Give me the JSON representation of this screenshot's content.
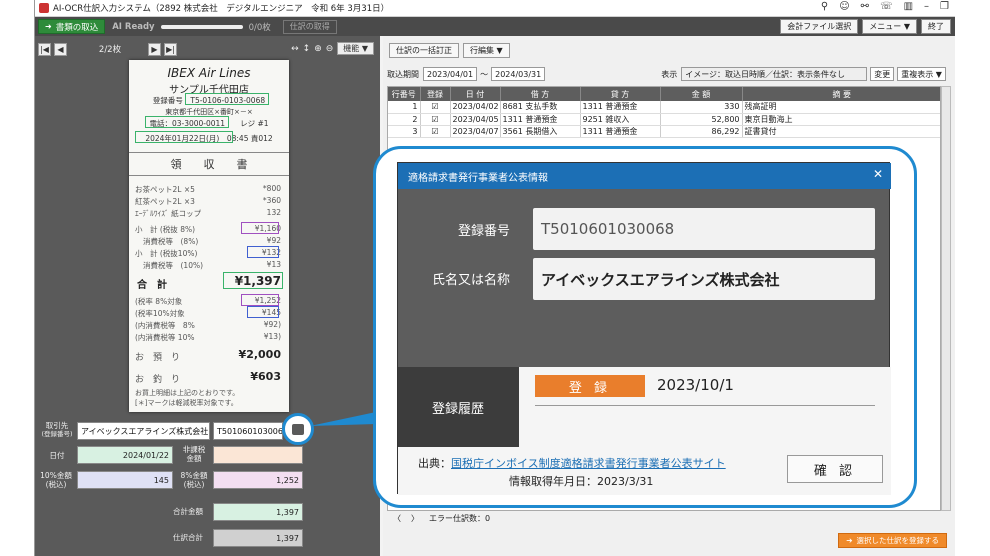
{
  "app": {
    "title": "AI-OCR仕訳入力システム（2892 株式会社　デジタルエンジニア　令和 6年 3月31日）",
    "import_button": "書類の取込",
    "ai_status": "AI Ready",
    "progress_count": "0/0枚",
    "fetch_button": "仕訳の取得",
    "account_file_button": "会計ファイル選択",
    "menu_button": "メニュー ▼",
    "exit_button": "終了"
  },
  "viewer": {
    "page_count": "2/2枚",
    "function_button": "機能 ▼"
  },
  "receipt": {
    "store_name": "IBEX Air Lines",
    "branch": "サンプル千代田店",
    "reg_no": "登録番号　T5-0106-0103-0068",
    "address": "東京都千代田区×番町×－×",
    "phone": "電話：03-3000-0011　　レジ #1",
    "datetime": "2024年01月22日(月)　08:45 責012",
    "heading": "領　　収　　書",
    "item1_name": "お茶ペット2L ×5",
    "item1_price": "*800",
    "item2_name": "紅茶ペット2L ×3",
    "item2_price": "*360",
    "item3_name": "ｴｰﾃﾞﾙﾜｲｽﾞ 紙コップ",
    "item3_price": "132",
    "sub8_label": "小　計 (税抜 8%)",
    "sub8_val": "¥1,160",
    "tax8_label": "消費税等　(8%)",
    "tax8_val": "¥92",
    "sub10_label": "小　計 (税抜10%)",
    "sub10_val": "¥132",
    "tax10_label": "消費税等　(10%)",
    "tax10_val": "¥13",
    "total_label": "合　計",
    "total_val": "¥1,397",
    "t8_label": "(税率 8%対象",
    "t8_val": "¥1,252",
    "t10_label": "(税率10%対象",
    "t10_val": "¥145",
    "in8_label": "(内消費税等　8%",
    "in8_val": "¥92)",
    "in10_label": "(内消費税等 10%",
    "in10_val": "¥13)",
    "paid_label": "お　預　り",
    "paid_val": "¥2,000",
    "change_label": "お　釣　り",
    "change_val": "¥603",
    "note1": "お買上明細は上記のとおりです。",
    "note2": "[＊]マークは軽減税率対象です。"
  },
  "form": {
    "partner_label": "取引先",
    "partner_sub": "(登録番号)",
    "partner_name": "アイベックスエアラインズ株式会社",
    "partner_reg": "T5010601030068",
    "date_label": "日付",
    "date_value": "2024/01/22",
    "nontax_label1": "非課税",
    "nontax_label2": "金額",
    "amt10_label1": "10%金額",
    "amt10_label2": "(税込)",
    "amt10_value": "145",
    "amt8_label1": "8%金額",
    "amt8_label2": "(税込)",
    "amt8_value": "1,252",
    "total_label": "合計金額",
    "total_value": "1,397",
    "journal_total_label": "仕訳合計",
    "journal_total_value": "1,397"
  },
  "journal": {
    "bulk_fix_button": "仕訳の一括訂正",
    "row_edit_button": "行編集 ▼",
    "period_label": "取込期間",
    "date_from": "2023/04/01",
    "tilde": "～",
    "date_to": "2024/03/31",
    "display_label": "表示",
    "display_value": "イメージ：取込日時順／仕訳：表示条件なし",
    "change_button": "変更",
    "dup_button": "重複表示 ▼",
    "headers": [
      "行番号",
      "登録",
      "日 付",
      "借 方",
      "貸 方",
      "金 額",
      "摘 要"
    ],
    "rows": [
      {
        "no": "1",
        "check": "☑",
        "date": "2023/04/02",
        "debit": "8681 支払手数",
        "credit": "1311 普通預金",
        "amount": "330",
        "memo": "残高証明"
      },
      {
        "no": "2",
        "check": "☑",
        "date": "2023/04/05",
        "debit": "1311 普通預金",
        "credit": "9251 雑収入",
        "amount": "52,800",
        "memo": "東京日動海上"
      },
      {
        "no": "3",
        "check": "☑",
        "date": "2023/04/07",
        "debit": "3561 長期借入",
        "credit": "1311 普通預金",
        "amount": "86,292",
        "memo": "証書貸付"
      }
    ],
    "error_count": "エラー仕訳数：0",
    "register_button": "選択した仕訳を登録する"
  },
  "dialog": {
    "title": "適格請求書発行事業者公表情報",
    "reg_label": "登録番号",
    "reg_value": "T5010601030068",
    "name_label": "氏名又は名称",
    "name_value": "アイベックスエアラインズ株式会社",
    "history_label": "登録履歴",
    "history_badge": "登 録",
    "history_date": "2023/10/1",
    "source_prefix": "出典：",
    "source_link": "国税庁インボイス制度適格請求書発行事業者公表サイト",
    "fetched": "情報取得年月日：2023/3/31",
    "confirm_button": "確 認"
  },
  "colors": {
    "dialog_title_bg": "#1c6fb5",
    "highlight_ring": "#1f8ad0",
    "badge_orange": "#e97e2c",
    "import_green": "#2e8b3a"
  }
}
